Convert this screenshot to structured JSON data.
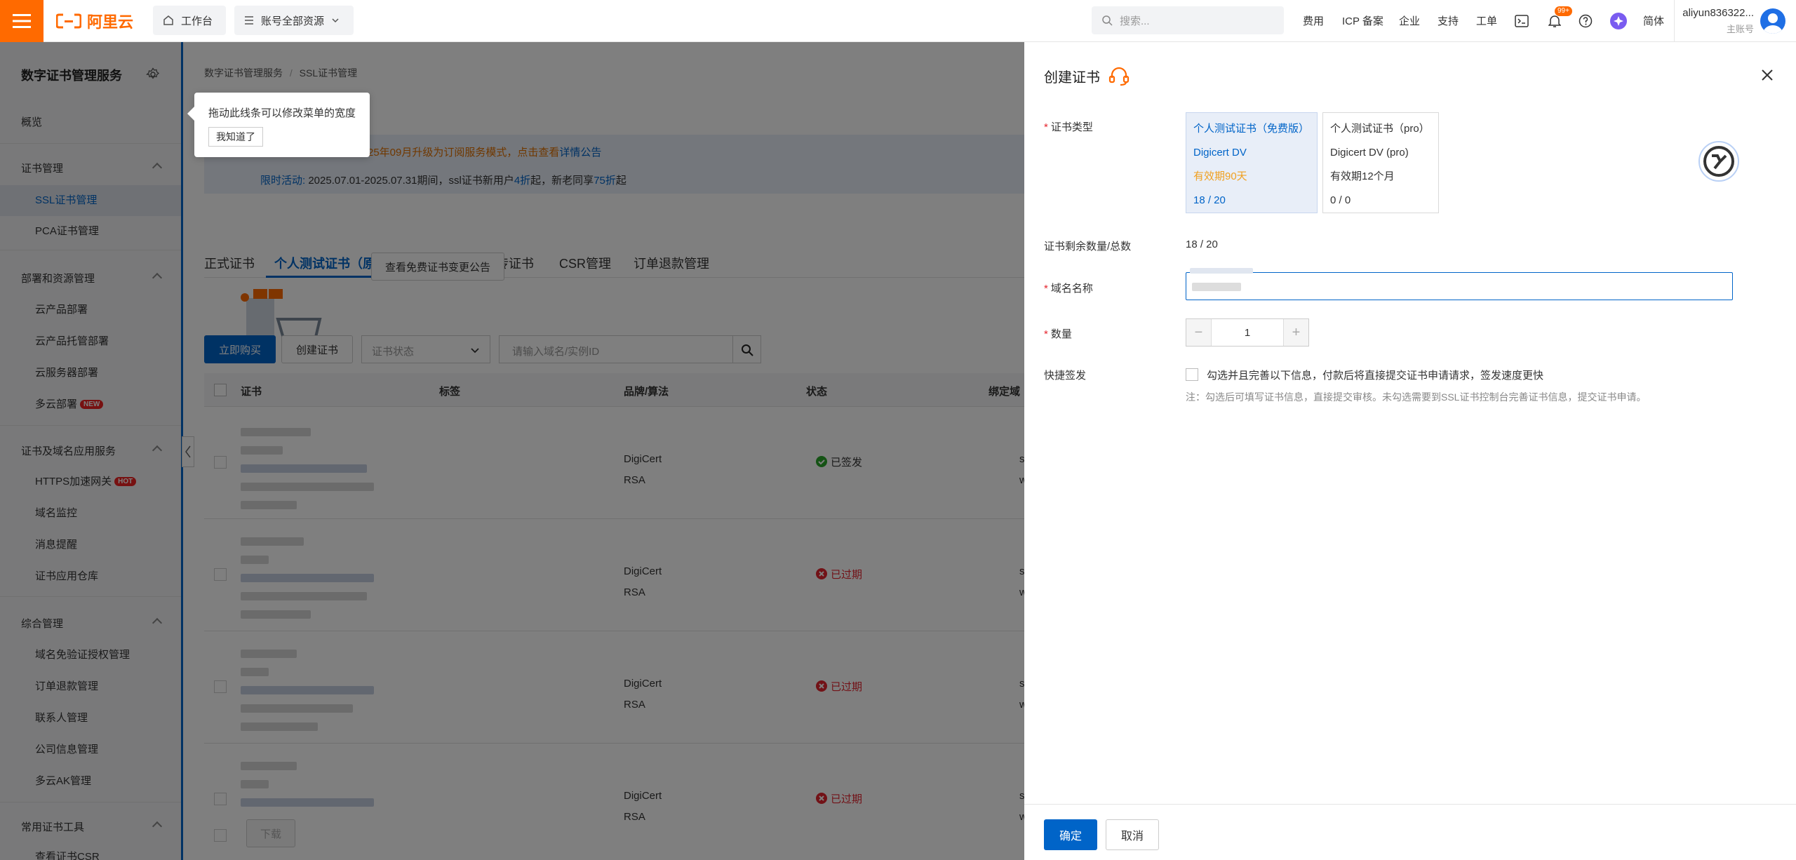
{
  "topbar": {
    "brand": "阿里云",
    "workbench": "工作台",
    "resources": "账号全部资源",
    "search_placeholder": "搜索...",
    "nav": [
      "费用",
      "ICP 备案",
      "企业",
      "支持",
      "工单"
    ],
    "badge": "99+",
    "lang": "简体",
    "account": "aliyun836322...",
    "account_role": "主账号"
  },
  "sidebar": {
    "title": "数字证书管理服务",
    "overview": "概览",
    "groups": [
      {
        "label": "证书管理",
        "items": [
          "SSL证书管理",
          "PCA证书管理"
        ]
      },
      {
        "label": "部署和资源管理",
        "items": [
          "云产品部署",
          "云产品托管部署",
          "云服务器部署",
          "多云部署"
        ]
      },
      {
        "label": "证书及域名应用服务",
        "items": [
          "HTTPS加速网关",
          "域名监控",
          "消息提醒",
          "证书应用仓库"
        ]
      },
      {
        "label": "综合管理",
        "items": [
          "域名免验证授权管理",
          "订单退款管理",
          "联系人管理",
          "公司信息管理",
          "多云AK管理"
        ]
      },
      {
        "label": "常用证书工具",
        "items": [
          "查看证书CSR"
        ]
      }
    ],
    "new_tag": "NEW",
    "hot_tag": "HOT"
  },
  "tooltip": {
    "text": "拖动此线条可以修改菜单的宽度",
    "button": "我知道了"
  },
  "main": {
    "breadcrumb": [
      "数字证书管理服务",
      "SSL证书管理"
    ],
    "notice1": "25年09月升级为订阅服务模式，点击查看",
    "notice1_link": "详情公告",
    "notice2_a": "限时活动:",
    "notice2_b": "2025.07.01-2025.07.31期间，ssl证书新用户",
    "notice2_c": "4折",
    "notice2_d": "起，新老同享",
    "notice2_e": "75折",
    "notice2_f": "起",
    "tabs": [
      "正式证书",
      "个人测试证书（原免费证书）",
      "上传证书",
      "CSR管理",
      "订单退款管理"
    ],
    "change_notice": "查看免费证书变更公告",
    "buy": "立即购买",
    "create": "创建证书",
    "status_filter": "证书状态",
    "search_placeholder": "请输入域名/实例ID",
    "columns": [
      "证书",
      "标签",
      "品牌/算法",
      "状态",
      "绑定域"
    ],
    "rows": [
      {
        "brand": "DigiCert",
        "algo": "RSA",
        "status": "已签发",
        "domain1": "smile",
        "domain2": "www."
      },
      {
        "brand": "DigiCert",
        "algo": "RSA",
        "status": "已过期",
        "domain1": "smile",
        "domain2": "www."
      },
      {
        "brand": "DigiCert",
        "algo": "RSA",
        "status": "已过期",
        "domain1": "smile",
        "domain2": "www."
      },
      {
        "brand": "DigiCert",
        "algo": "RSA",
        "status": "已过期",
        "domain1": "smile",
        "domain2": "www."
      }
    ],
    "download": "下载"
  },
  "drawer": {
    "title": "创建证书",
    "cert_type_label": "证书类型",
    "type_cards": [
      {
        "name": "个人测试证书（免费版）",
        "brand": "Digicert DV",
        "validity": "有效期90天",
        "count": "18 / 20"
      },
      {
        "name": "个人测试证书（pro）",
        "brand": "Digicert DV (pro)",
        "validity": "有效期12个月",
        "count": "0 / 0"
      }
    ],
    "remaining_label": "证书剩余数量/总数",
    "remaining_value": "18 / 20",
    "domain_label": "域名名称",
    "qty_label": "数量",
    "qty_value": "1",
    "qty_minus": "−",
    "qty_plus": "+",
    "fast_label": "快捷签发",
    "fast_check_text": "勾选并且完善以下信息，付款后将直接提交证书申请请求，签发速度更快",
    "fast_note": "注：勾选后可填写证书信息，直接提交审核。未勾选需要到SSL证书控制台完善证书信息，提交证书申请。",
    "confirm": "确定",
    "cancel": "取消"
  },
  "colors": {
    "accent": "#0064c8",
    "brand": "#ff6a00",
    "success": "#2aa62a",
    "danger": "#e5252e"
  }
}
